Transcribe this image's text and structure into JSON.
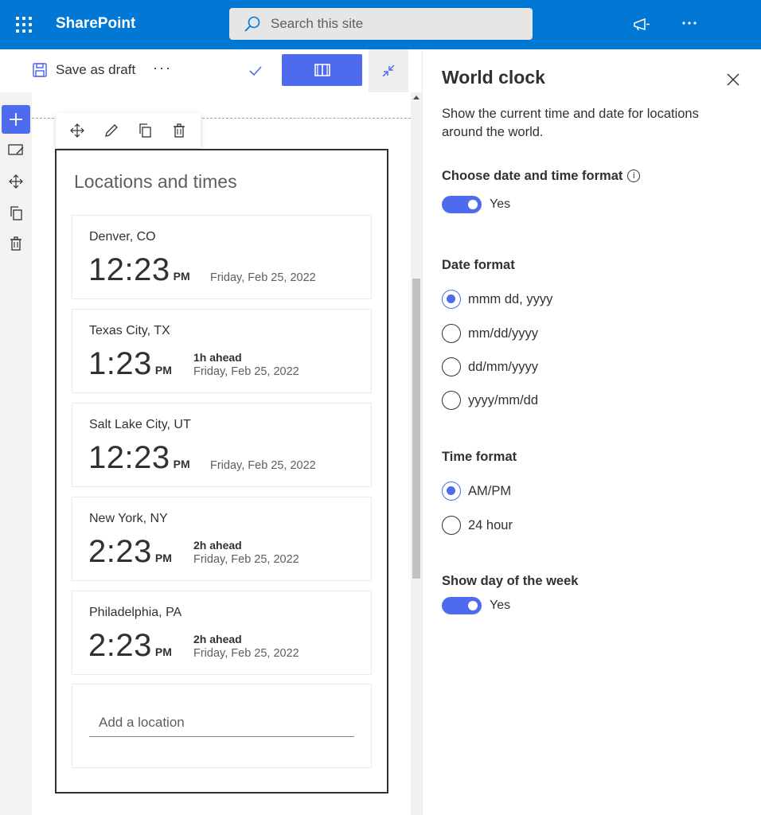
{
  "topbar": {
    "brand": "SharePoint",
    "search_placeholder": "Search this site"
  },
  "commandbar": {
    "save_draft_label": "Save as draft",
    "more_label": "···"
  },
  "webpart": {
    "title": "Locations and times",
    "locations": [
      {
        "city": "Denver, CO",
        "time": "12:23",
        "ampm": "PM",
        "ahead": "",
        "date": "Friday, Feb 25, 2022"
      },
      {
        "city": "Texas City, TX",
        "time": "1:23",
        "ampm": "PM",
        "ahead": "1h ahead",
        "date": "Friday, Feb 25, 2022"
      },
      {
        "city": "Salt Lake City, UT",
        "time": "12:23",
        "ampm": "PM",
        "ahead": "",
        "date": "Friday, Feb 25, 2022"
      },
      {
        "city": "New York, NY",
        "time": "2:23",
        "ampm": "PM",
        "ahead": "2h ahead",
        "date": "Friday, Feb 25, 2022"
      },
      {
        "city": "Philadelphia, PA",
        "time": "2:23",
        "ampm": "PM",
        "ahead": "2h ahead",
        "date": "Friday, Feb 25, 2022"
      }
    ],
    "add_location_placeholder": "Add a location"
  },
  "pane": {
    "title": "World clock",
    "description": "Show the current time and date for locations around the world.",
    "choose_format_label": "Choose date and time format",
    "info_glyph": "i",
    "choose_format_toggle": "Yes",
    "date_format_label": "Date format",
    "date_formats": [
      "mmm dd, yyyy",
      "mm/dd/yyyy",
      "dd/mm/yyyy",
      "yyyy/mm/dd"
    ],
    "date_format_selected": "mmm dd, yyyy",
    "time_format_label": "Time format",
    "time_formats": [
      "AM/PM",
      "24 hour"
    ],
    "time_format_selected": "AM/PM",
    "show_day_label": "Show day of the week",
    "show_day_toggle": "Yes"
  },
  "colors": {
    "suite_bar": "#0078d4",
    "accent": "#4f6bed"
  }
}
